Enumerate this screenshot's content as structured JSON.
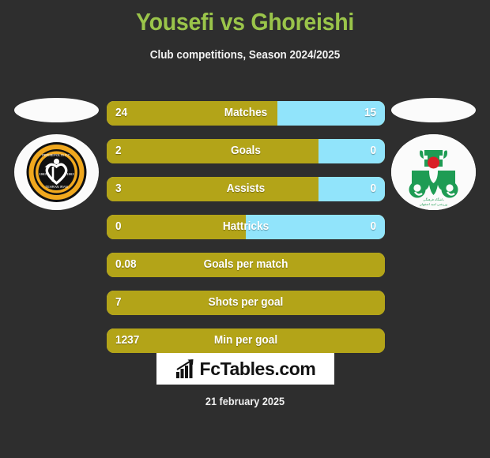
{
  "header": {
    "title": "Yousefi vs Ghoreishi",
    "subtitle": "Club competitions, Season 2024/2025",
    "title_color": "#9ac44a"
  },
  "colors": {
    "background": "#2e2e2e",
    "home_bar": "#b3a418",
    "away_bar": "#91e4fb",
    "text": "#ffffff",
    "logo_panel": "#fbfbfb"
  },
  "teams": {
    "home": {
      "badge_icon": "home-club-crest-icon",
      "badge_colors": [
        "#101010",
        "#f0a81e",
        "#ffffff"
      ]
    },
    "away": {
      "badge_icon": "away-club-crest-icon",
      "badge_colors": [
        "#1e9c54",
        "#d91f26",
        "#ffffff"
      ]
    }
  },
  "chart_data": {
    "type": "bar",
    "title": "Yousefi vs Ghoreishi",
    "subtitle": "Club competitions, Season 2024/2025",
    "categories": [
      "Matches",
      "Goals",
      "Assists",
      "Hattricks",
      "Goals per match",
      "Shots per goal",
      "Min per goal"
    ],
    "series": [
      {
        "name": "Yousefi",
        "values": [
          "24",
          "2",
          "3",
          "0",
          "0.08",
          "7",
          "1237"
        ]
      },
      {
        "name": "Ghoreishi",
        "values": [
          "15",
          "0",
          "0",
          "0",
          "",
          "",
          ""
        ]
      }
    ],
    "legend": "none",
    "grid": false
  },
  "stats": [
    {
      "label": "Matches",
      "home": "24",
      "away": "15",
      "home_pct": 61.5,
      "split": true
    },
    {
      "label": "Goals",
      "home": "2",
      "away": "0",
      "home_pct": 76.0,
      "split": true
    },
    {
      "label": "Assists",
      "home": "3",
      "away": "0",
      "home_pct": 76.0,
      "split": true
    },
    {
      "label": "Hattricks",
      "home": "0",
      "away": "0",
      "home_pct": 50.0,
      "split": true
    },
    {
      "label": "Goals per match",
      "home": "0.08",
      "away": "",
      "home_pct": 100,
      "split": false
    },
    {
      "label": "Shots per goal",
      "home": "7",
      "away": "",
      "home_pct": 100,
      "split": false
    },
    {
      "label": "Min per goal",
      "home": "1237",
      "away": "",
      "home_pct": 100,
      "split": false
    }
  ],
  "footer": {
    "brand": "FcTables.com",
    "brand_icon": "bar-chart-growth-icon",
    "date": "21 february 2025"
  }
}
